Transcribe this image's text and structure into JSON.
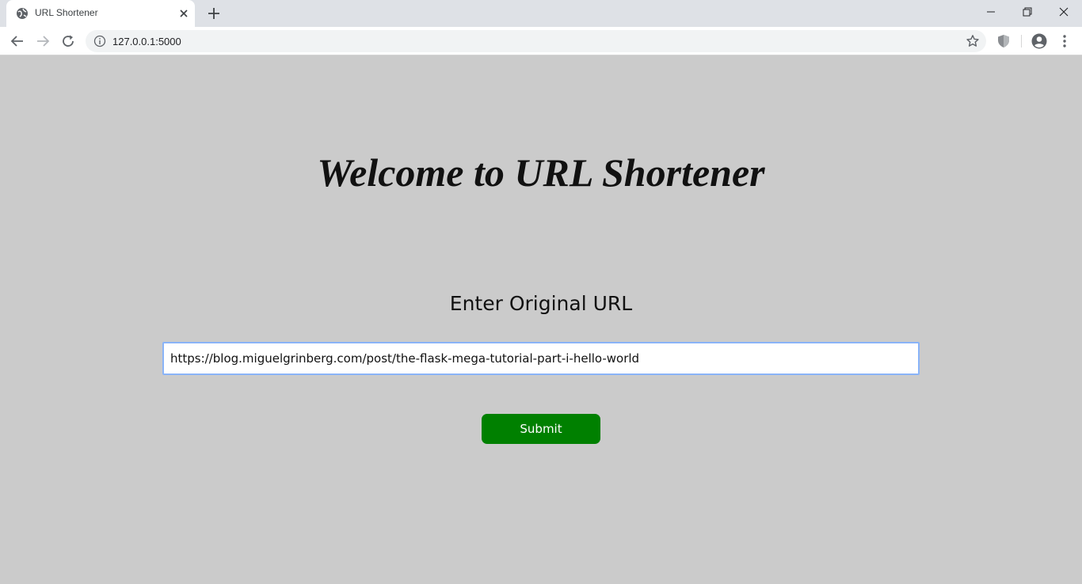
{
  "browser": {
    "tab": {
      "title": "URL Shortener",
      "favicon": "globe-icon"
    },
    "address": "127.0.0.1:5000",
    "colors": {
      "tabstrip": "#dee1e6",
      "toolbar": "#ffffff",
      "omnibox": "#f1f3f4"
    }
  },
  "page": {
    "headline": "Welcome to URL Shortener",
    "field_label": "Enter Original URL",
    "url_input": {
      "value": "https://blog.miguelgrinberg.com/post/the-flask-mega-tutorial-part-i-hello-world",
      "placeholder": ""
    },
    "submit_label": "Submit",
    "colors": {
      "background": "#cbcbcb",
      "button": "#008000",
      "button_text": "#ffffff",
      "input_focus": "#8ab4f8"
    }
  }
}
